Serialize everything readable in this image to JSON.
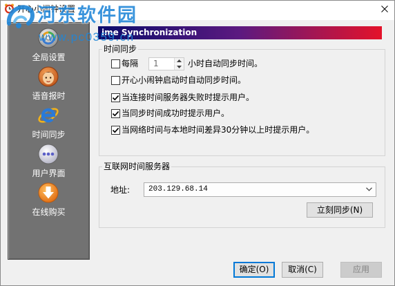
{
  "window": {
    "title": "开心小闹钟设置",
    "app_icon": "alarm-clock-icon",
    "close_icon": "close-icon"
  },
  "watermark": {
    "site_name": "河东软件园",
    "url": "www.pc0359.cn",
    "logo_icon": "swirl-logo-icon"
  },
  "sidebar": {
    "items": [
      {
        "label": "全局设置",
        "icon": "global-settings-icon"
      },
      {
        "label": "语音报时",
        "icon": "voice-face-icon"
      },
      {
        "label": "时间同步",
        "icon": "internet-explorer-icon"
      },
      {
        "label": "用户界面",
        "icon": "user-interface-icon"
      },
      {
        "label": "在线购买",
        "icon": "download-arrow-icon"
      }
    ]
  },
  "banner": {
    "text": "ime Synchronization"
  },
  "time_sync": {
    "title": "时间同步",
    "interval": {
      "checked": false,
      "prefix": "每隔",
      "hours": "1",
      "suffix": "小时自动同步时间。",
      "spin_disabled": true
    },
    "options": [
      {
        "label": "开心小闹钟启动时自动同步时间。",
        "checked": false
      },
      {
        "label": "当连接时间服务器失败时提示用户。",
        "checked": true
      },
      {
        "label": "当同步时间成功时提示用户。",
        "checked": true
      },
      {
        "label": "当网络时间与本地时间差异30分钟以上时提示用户。",
        "checked": true
      }
    ]
  },
  "time_server": {
    "title": "互联网时间服务器",
    "address_label": "地址:",
    "address_value": "203.129.68.14",
    "sync_now_label": "立刻同步(N)"
  },
  "footer": {
    "ok_label": "确定(O)",
    "cancel_label": "取消(C)",
    "apply_label": "应用",
    "apply_disabled": true
  },
  "colors": {
    "dialog_bg": "#f0f0f0",
    "sidebar_bg": "#727272",
    "banner_start": "#0b0b6b",
    "banner_mid": "#5c1a80",
    "banner_end": "#e4122a",
    "accent": "#0078d7",
    "watermark": "#1f86d8"
  }
}
